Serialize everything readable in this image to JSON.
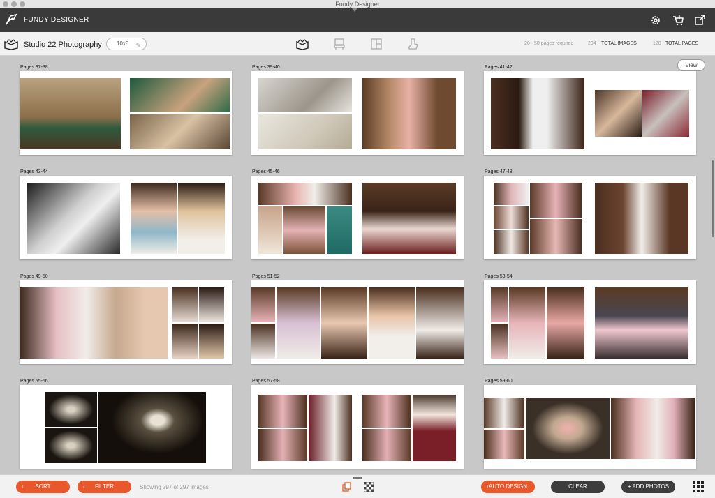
{
  "window": {
    "title": "Fundy Designer"
  },
  "appbar": {
    "app_name": "FUNDY DESIGNER"
  },
  "toolbar": {
    "project_name": "Studio 22 Photography",
    "album_size": "10x8",
    "pages_required": "20 - 50 pages required",
    "total_images_count": "294",
    "total_images_label": "TOTAL IMAGES",
    "total_pages_count": "120",
    "total_pages_label": "TOTAL PAGES"
  },
  "content": {
    "view_label": "View",
    "spreads": [
      {
        "label": "Pages 37-38"
      },
      {
        "label": "Pages 39-40"
      },
      {
        "label": "Pages 41-42"
      },
      {
        "label": "Pages 43-44"
      },
      {
        "label": "Pages 45-46"
      },
      {
        "label": "Pages 47-48"
      },
      {
        "label": "Pages 49-50"
      },
      {
        "label": "Pages 51-52"
      },
      {
        "label": "Pages 53-54"
      },
      {
        "label": "Pages 55-56"
      },
      {
        "label": "Pages 57-58"
      },
      {
        "label": "Pages 59-60"
      }
    ]
  },
  "bottombar": {
    "sort_label": "SORT",
    "filter_label": "FILTER",
    "showing_text": "Showing 297 of 297 images",
    "auto_design_label": "AUTO DESIGN",
    "clear_label": "CLEAR",
    "add_photos_label": "+ ADD PHOTOS"
  },
  "colors": {
    "accent": "#e8582a",
    "header": "#3a3a3a",
    "background": "#c8c8c8"
  }
}
